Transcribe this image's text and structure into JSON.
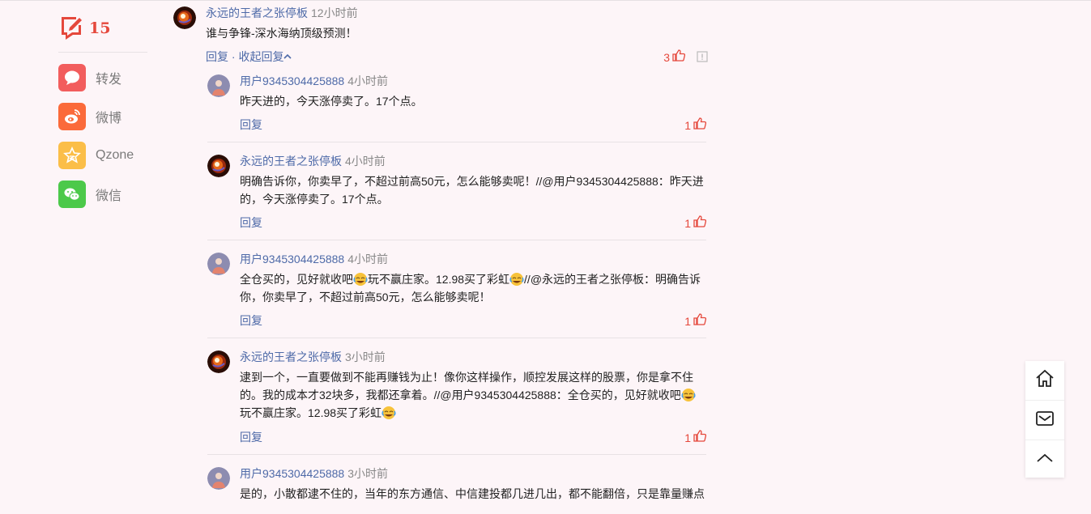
{
  "share": {
    "comment_count": "15",
    "items": [
      {
        "label": "转发",
        "icon": "chat-bubble-icon",
        "color": "#f25d5d"
      },
      {
        "label": "微博",
        "icon": "weibo-icon",
        "color": "#fb6a3a"
      },
      {
        "label": "Qzone",
        "icon": "qzone-star-icon",
        "color": "#fbbe48"
      },
      {
        "label": "微信",
        "icon": "wechat-icon",
        "color": "#4cc94a"
      }
    ]
  },
  "main_comment": {
    "user": "永远的王者之张停板",
    "time": "12小时前",
    "text": "谁与争锋-深水海纳顶级预测！",
    "reply_label": "回复",
    "separator": " · ",
    "collapse_label": "收起回复",
    "likes": "3"
  },
  "replies": [
    {
      "user": "用户9345304425888",
      "time": "4小时前",
      "text": "昨天进的，今天涨停卖了。17个点。",
      "reply_label": "回复",
      "likes": "1"
    },
    {
      "user": "永远的王者之张停板",
      "time": "4小时前",
      "text": "明确告诉你，你卖早了，不超过前高50元，怎么能够卖呢！//@用户9345304425888：昨天进的，今天涨停卖了。17个点。",
      "reply_label": "回复",
      "likes": "1"
    },
    {
      "user": "用户9345304425888",
      "time": "4小时前",
      "text_parts": [
        "全仓买的，见好就收吧",
        "玩不赢庄家。12.98买了彩虹",
        "//@永远的王者之张停板：明确告诉你，你卖早了，不超过前高50元，怎么能够卖呢！"
      ],
      "reply_label": "回复",
      "likes": "1"
    },
    {
      "user": "永远的王者之张停板",
      "time": "3小时前",
      "text_parts": [
        "逮到一个，一直要做到不能再赚钱为止！像你这样操作，顺控发展这样的股票，你是拿不住的。我的成本才32块多，我都还拿着。//@用户9345304425888：全仓买的，见好就收吧",
        "玩不赢庄家。12.98买了彩虹"
      ],
      "reply_label": "回复",
      "likes": "1"
    },
    {
      "user": "用户9345304425888",
      "time": "3小时前",
      "text": "是的，小散都逮不住的，当年的东方通信、中信建投都几进几出，都不能翻倍，只是靠量赚点"
    }
  ],
  "float_tools": [
    "home-icon",
    "mail-icon",
    "back-to-top-icon"
  ]
}
